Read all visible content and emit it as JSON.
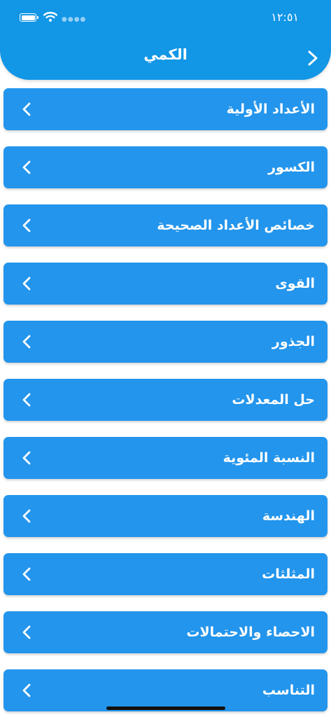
{
  "status_bar": {
    "time": "١٢:٥١"
  },
  "header": {
    "title": "الكمي"
  },
  "items": [
    {
      "label": "الأعداد الأولية"
    },
    {
      "label": "الكسور"
    },
    {
      "label": "خصائص الأعداد الصحيحة"
    },
    {
      "label": "القوى"
    },
    {
      "label": "الجذور"
    },
    {
      "label": "حل المعدلات"
    },
    {
      "label": "النسبة المئوية"
    },
    {
      "label": "الهندسة"
    },
    {
      "label": "المثلثات"
    },
    {
      "label": "الاحصاء والاحتمالات"
    },
    {
      "label": "التناسب"
    }
  ],
  "colors": {
    "header": "#1296e6",
    "item": "#2395ec",
    "text": "#ffffff"
  },
  "icons": {
    "back": "chevron-right-icon",
    "item": "chevron-left-icon"
  }
}
